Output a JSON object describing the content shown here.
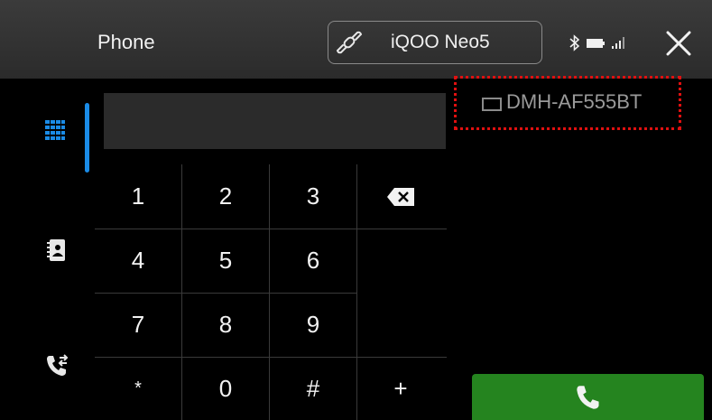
{
  "header": {
    "title": "Phone",
    "device_name": "iQOO Neo5"
  },
  "sidebar": {
    "items": [
      {
        "name": "keypad",
        "icon": "dialpad-icon",
        "active": true
      },
      {
        "name": "contacts",
        "icon": "contacts-icon",
        "active": false
      },
      {
        "name": "call-history",
        "icon": "call-history-icon",
        "active": false
      }
    ]
  },
  "dialer": {
    "number": ""
  },
  "keypad": {
    "keys": [
      "1",
      "2",
      "3",
      "4",
      "5",
      "6",
      "7",
      "8",
      "9",
      "*",
      "0",
      "#",
      "+"
    ]
  },
  "model_label": "DMH-AF555BT",
  "colors": {
    "accent": "#1a8be6",
    "call_green": "#25841f",
    "highlight_red": "#e01010"
  }
}
